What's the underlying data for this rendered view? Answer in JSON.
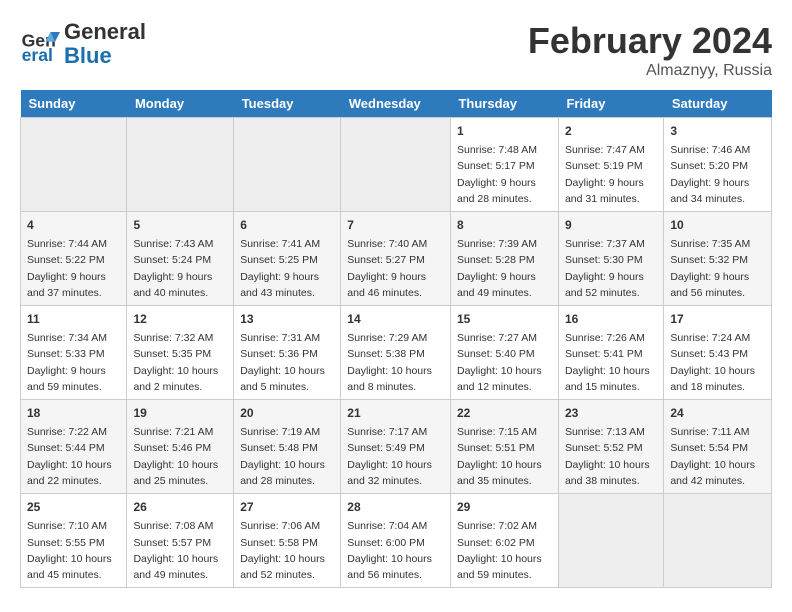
{
  "logo": {
    "line1": "General",
    "line2": "Blue"
  },
  "title": "February 2024",
  "location": "Almaznyy, Russia",
  "days_header": [
    "Sunday",
    "Monday",
    "Tuesday",
    "Wednesday",
    "Thursday",
    "Friday",
    "Saturday"
  ],
  "weeks": [
    [
      {
        "day": "",
        "info": ""
      },
      {
        "day": "",
        "info": ""
      },
      {
        "day": "",
        "info": ""
      },
      {
        "day": "",
        "info": ""
      },
      {
        "day": "1",
        "info": "Sunrise: 7:48 AM\nSunset: 5:17 PM\nDaylight: 9 hours\nand 28 minutes."
      },
      {
        "day": "2",
        "info": "Sunrise: 7:47 AM\nSunset: 5:19 PM\nDaylight: 9 hours\nand 31 minutes."
      },
      {
        "day": "3",
        "info": "Sunrise: 7:46 AM\nSunset: 5:20 PM\nDaylight: 9 hours\nand 34 minutes."
      }
    ],
    [
      {
        "day": "4",
        "info": "Sunrise: 7:44 AM\nSunset: 5:22 PM\nDaylight: 9 hours\nand 37 minutes."
      },
      {
        "day": "5",
        "info": "Sunrise: 7:43 AM\nSunset: 5:24 PM\nDaylight: 9 hours\nand 40 minutes."
      },
      {
        "day": "6",
        "info": "Sunrise: 7:41 AM\nSunset: 5:25 PM\nDaylight: 9 hours\nand 43 minutes."
      },
      {
        "day": "7",
        "info": "Sunrise: 7:40 AM\nSunset: 5:27 PM\nDaylight: 9 hours\nand 46 minutes."
      },
      {
        "day": "8",
        "info": "Sunrise: 7:39 AM\nSunset: 5:28 PM\nDaylight: 9 hours\nand 49 minutes."
      },
      {
        "day": "9",
        "info": "Sunrise: 7:37 AM\nSunset: 5:30 PM\nDaylight: 9 hours\nand 52 minutes."
      },
      {
        "day": "10",
        "info": "Sunrise: 7:35 AM\nSunset: 5:32 PM\nDaylight: 9 hours\nand 56 minutes."
      }
    ],
    [
      {
        "day": "11",
        "info": "Sunrise: 7:34 AM\nSunset: 5:33 PM\nDaylight: 9 hours\nand 59 minutes."
      },
      {
        "day": "12",
        "info": "Sunrise: 7:32 AM\nSunset: 5:35 PM\nDaylight: 10 hours\nand 2 minutes."
      },
      {
        "day": "13",
        "info": "Sunrise: 7:31 AM\nSunset: 5:36 PM\nDaylight: 10 hours\nand 5 minutes."
      },
      {
        "day": "14",
        "info": "Sunrise: 7:29 AM\nSunset: 5:38 PM\nDaylight: 10 hours\nand 8 minutes."
      },
      {
        "day": "15",
        "info": "Sunrise: 7:27 AM\nSunset: 5:40 PM\nDaylight: 10 hours\nand 12 minutes."
      },
      {
        "day": "16",
        "info": "Sunrise: 7:26 AM\nSunset: 5:41 PM\nDaylight: 10 hours\nand 15 minutes."
      },
      {
        "day": "17",
        "info": "Sunrise: 7:24 AM\nSunset: 5:43 PM\nDaylight: 10 hours\nand 18 minutes."
      }
    ],
    [
      {
        "day": "18",
        "info": "Sunrise: 7:22 AM\nSunset: 5:44 PM\nDaylight: 10 hours\nand 22 minutes."
      },
      {
        "day": "19",
        "info": "Sunrise: 7:21 AM\nSunset: 5:46 PM\nDaylight: 10 hours\nand 25 minutes."
      },
      {
        "day": "20",
        "info": "Sunrise: 7:19 AM\nSunset: 5:48 PM\nDaylight: 10 hours\nand 28 minutes."
      },
      {
        "day": "21",
        "info": "Sunrise: 7:17 AM\nSunset: 5:49 PM\nDaylight: 10 hours\nand 32 minutes."
      },
      {
        "day": "22",
        "info": "Sunrise: 7:15 AM\nSunset: 5:51 PM\nDaylight: 10 hours\nand 35 minutes."
      },
      {
        "day": "23",
        "info": "Sunrise: 7:13 AM\nSunset: 5:52 PM\nDaylight: 10 hours\nand 38 minutes."
      },
      {
        "day": "24",
        "info": "Sunrise: 7:11 AM\nSunset: 5:54 PM\nDaylight: 10 hours\nand 42 minutes."
      }
    ],
    [
      {
        "day": "25",
        "info": "Sunrise: 7:10 AM\nSunset: 5:55 PM\nDaylight: 10 hours\nand 45 minutes."
      },
      {
        "day": "26",
        "info": "Sunrise: 7:08 AM\nSunset: 5:57 PM\nDaylight: 10 hours\nand 49 minutes."
      },
      {
        "day": "27",
        "info": "Sunrise: 7:06 AM\nSunset: 5:58 PM\nDaylight: 10 hours\nand 52 minutes."
      },
      {
        "day": "28",
        "info": "Sunrise: 7:04 AM\nSunset: 6:00 PM\nDaylight: 10 hours\nand 56 minutes."
      },
      {
        "day": "29",
        "info": "Sunrise: 7:02 AM\nSunset: 6:02 PM\nDaylight: 10 hours\nand 59 minutes."
      },
      {
        "day": "",
        "info": ""
      },
      {
        "day": "",
        "info": ""
      }
    ]
  ]
}
